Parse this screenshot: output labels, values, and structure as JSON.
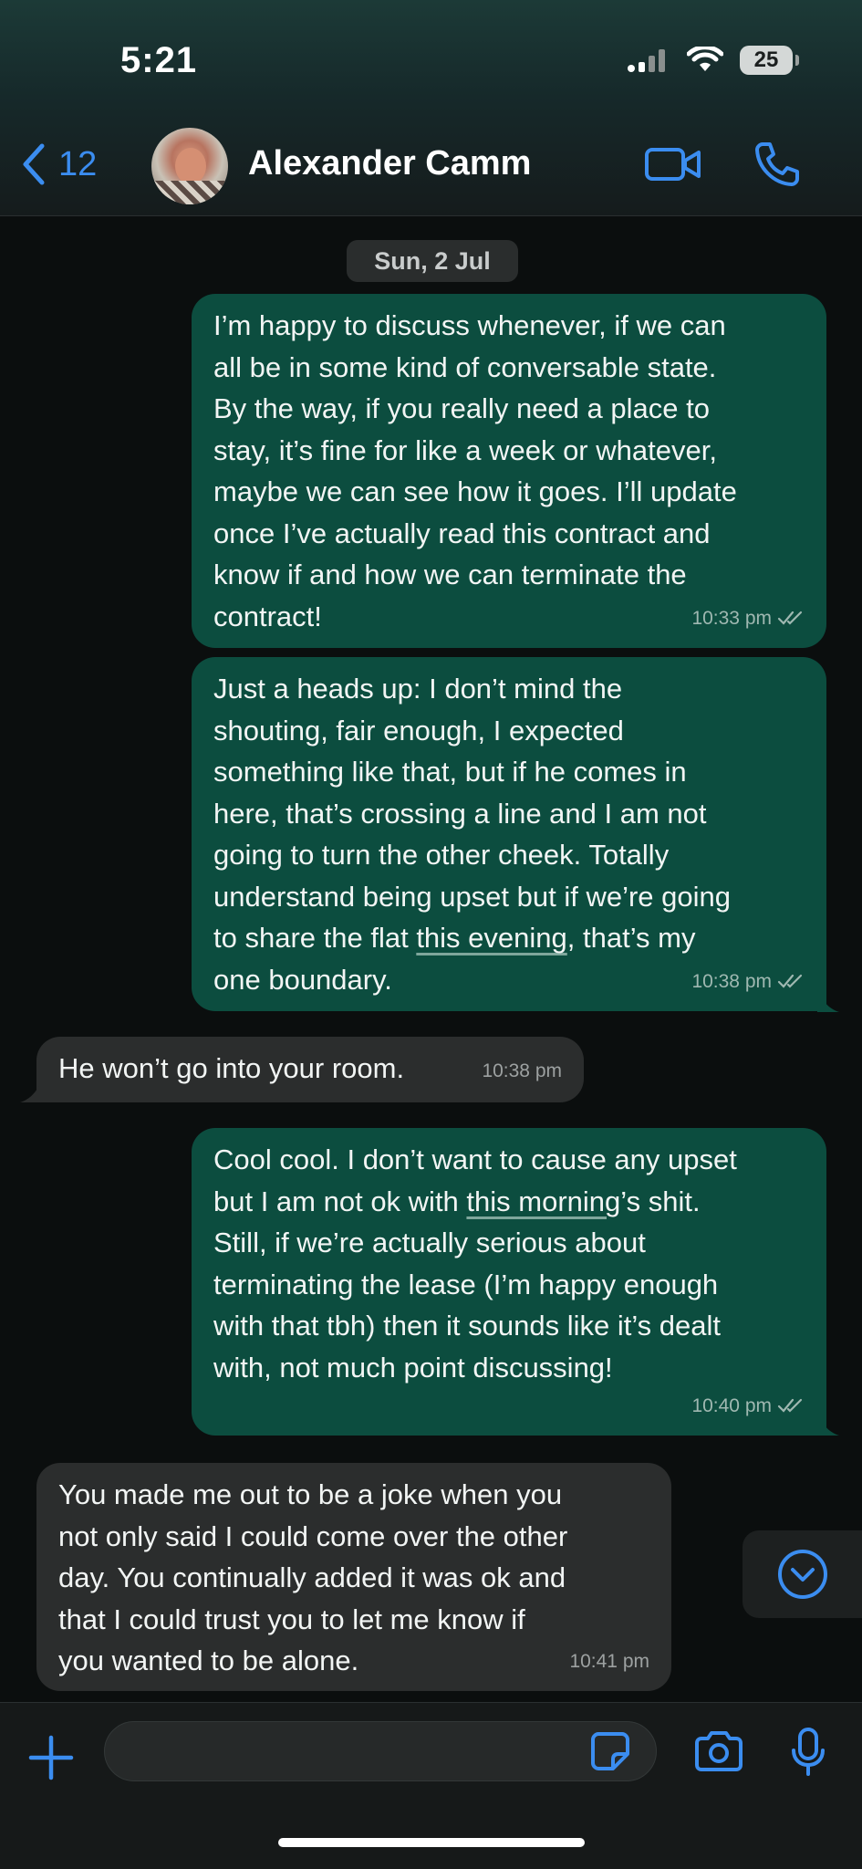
{
  "status_bar": {
    "time": "5:21",
    "battery": "25"
  },
  "header": {
    "back_count": "12",
    "contact_name": "Alexander Camm"
  },
  "chat": {
    "date_chip": "Sun, 2 Jul",
    "messages": [
      {
        "direction": "outgoing",
        "lines": [
          "I’m happy to discuss whenever, if we can",
          "all be in some kind of conversable state.",
          "By the way, if you really need a place to",
          "stay, it’s fine for like a week or whatever,",
          "maybe we can see how it goes. I’ll update",
          "once I’ve actually read this contract and",
          "know if and how we can terminate the",
          "contract!"
        ],
        "time": "10:33 pm",
        "read": true
      },
      {
        "direction": "outgoing",
        "lines": [
          "Just a heads up: I don’t mind the",
          "shouting, fair enough, I expected",
          "something like that, but if he comes in",
          "here, that’s crossing a line and I am not",
          "going to turn the other cheek. Totally",
          "understand being upset but if we’re going",
          "to share the flat ",
          "this evening",
          ", that’s my",
          "one boundary."
        ],
        "time": "10:38 pm",
        "read": true
      },
      {
        "direction": "incoming",
        "text": "He won’t go into your room.",
        "time": "10:38 pm"
      },
      {
        "direction": "outgoing",
        "lines": [
          "Cool cool. I don’t want to cause any upset",
          "but I am not ok with ",
          "this morning",
          "’s shit.",
          "Still, if we’re actually serious about",
          "terminating the lease (I’m happy enough",
          "with that tbh) then it sounds like it’s dealt",
          "with, not much point discussing!"
        ],
        "time": "10:40 pm",
        "read": true
      },
      {
        "direction": "incoming",
        "lines": [
          "You made me out to be a joke when you",
          "not only said I could come over the other",
          "day. You continually added it was ok and",
          "that I could trust you to let me know if",
          "you wanted to be alone."
        ],
        "time": "10:41 pm"
      }
    ]
  },
  "icons": {
    "back": "chevron-left-icon",
    "video": "video-camera-icon",
    "call": "phone-icon",
    "scroll": "chevron-down-circle-icon",
    "plus": "plus-icon",
    "sticker": "sticker-icon",
    "camera": "camera-icon",
    "mic": "microphone-icon"
  },
  "colors": {
    "accent": "#3b8df0",
    "outgoing_bubble": "#0c4d3f",
    "incoming_bubble": "#2b2d2d"
  }
}
